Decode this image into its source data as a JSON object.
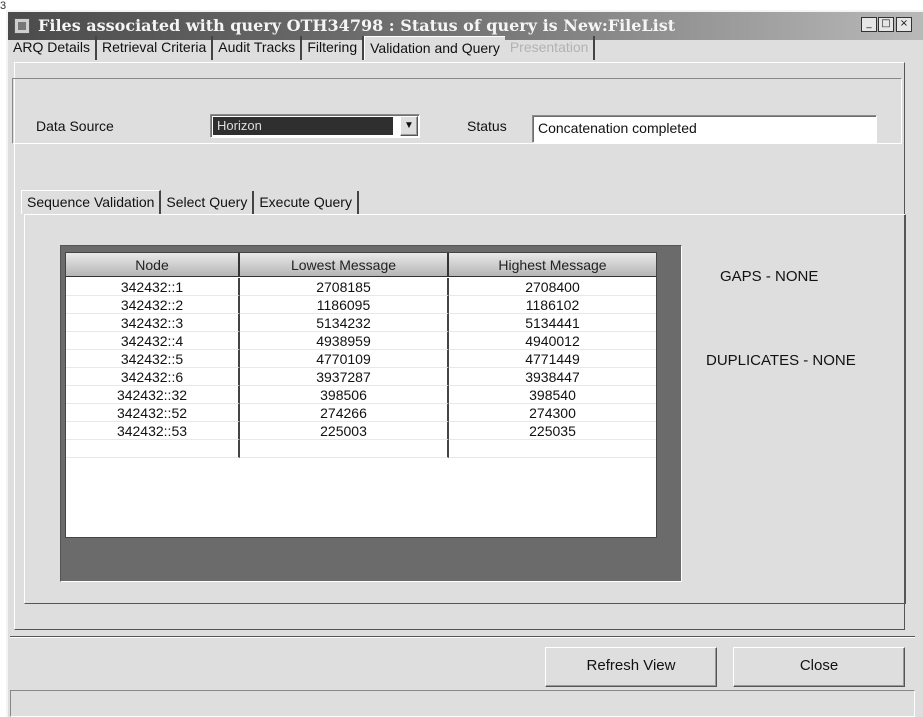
{
  "corner_mark": "3",
  "window": {
    "title": "Files associated with query OTH34798 : Status of query is New:FileList",
    "title_buttons": [
      "_",
      "□",
      "×"
    ]
  },
  "main_tabs": [
    {
      "label": "ARQ Details",
      "state": "normal"
    },
    {
      "label": "Retrieval Criteria",
      "state": "normal"
    },
    {
      "label": "Audit Tracks",
      "state": "normal"
    },
    {
      "label": "Filtering",
      "state": "normal"
    },
    {
      "label": "Validation and Query",
      "state": "active"
    },
    {
      "label": "Presentation",
      "state": "disabled"
    }
  ],
  "data_source": {
    "label": "Data Source",
    "selected": "Horizon",
    "status_label": "Status",
    "status_value": "Concatenation completed"
  },
  "sub_tabs": [
    {
      "label": "Sequence Validation",
      "state": "active"
    },
    {
      "label": "Select Query",
      "state": "normal"
    },
    {
      "label": "Execute Query",
      "state": "normal"
    }
  ],
  "table": {
    "columns": [
      "Node",
      "Lowest Message",
      "Highest Message"
    ],
    "rows": [
      [
        "342432::1",
        "2708185",
        "2708400"
      ],
      [
        "342432::2",
        "1186095",
        "1186102"
      ],
      [
        "342432::3",
        "5134232",
        "5134441"
      ],
      [
        "342432::4",
        "4938959",
        "4940012"
      ],
      [
        "342432::5",
        "4770109",
        "4771449"
      ],
      [
        "342432::6",
        "3937287",
        "3938447"
      ],
      [
        "342432::32",
        "398506",
        "398540"
      ],
      [
        "342432::52",
        "274266",
        "274300"
      ],
      [
        "342432::53",
        "225003",
        "225035"
      ]
    ]
  },
  "summary": {
    "gaps": "GAPS - NONE",
    "duplicates": "DUPLICATES - NONE"
  },
  "buttons": {
    "refresh": "Refresh View",
    "close": "Close"
  }
}
